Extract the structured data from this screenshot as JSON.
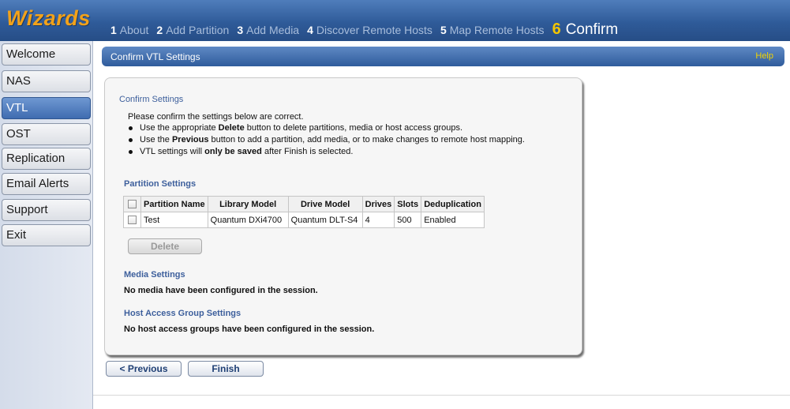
{
  "brand": "Wizards",
  "steps": [
    {
      "num": "1",
      "label": "About"
    },
    {
      "num": "2",
      "label": "Add Partition"
    },
    {
      "num": "3",
      "label": "Add Media"
    },
    {
      "num": "4",
      "label": "Discover Remote Hosts"
    },
    {
      "num": "5",
      "label": "Map Remote Hosts"
    },
    {
      "num": "6",
      "label": "Confirm"
    }
  ],
  "sidebar": {
    "items": [
      {
        "label": "Welcome"
      },
      {
        "label": "NAS"
      },
      {
        "label": "VTL"
      },
      {
        "label": "OST"
      },
      {
        "label": "Replication"
      },
      {
        "label": "Email Alerts"
      },
      {
        "label": "Support"
      },
      {
        "label": "Exit"
      }
    ],
    "active": "VTL"
  },
  "panel": {
    "title": "Confirm VTL Settings",
    "help": "Help"
  },
  "confirm": {
    "title": "Confirm Settings",
    "intro": "Please confirm the settings below are correct.",
    "bullets": [
      {
        "pre": "Use the appropriate ",
        "bold": "Delete",
        "post": " button to delete partitions, media or host access groups."
      },
      {
        "pre": "Use the ",
        "bold": "Previous",
        "post": " button to add a partition, add media, or to make changes to remote host mapping."
      },
      {
        "pre": "VTL settings will ",
        "bold": "only be saved",
        "post": " after Finish is selected."
      }
    ]
  },
  "partition": {
    "title": "Partition Settings",
    "columns": [
      "Partition Name",
      "Library Model",
      "Drive Model",
      "Drives",
      "Slots",
      "Deduplication"
    ],
    "rows": [
      [
        "Test",
        "Quantum DXi4700",
        "Quantum DLT-S4",
        "4",
        "500",
        "Enabled"
      ]
    ],
    "delete_label": "Delete"
  },
  "media": {
    "title": "Media Settings",
    "message": "No media have been configured in the session."
  },
  "hostaccess": {
    "title": "Host Access Group Settings",
    "message": "No host access groups have been configured in the session."
  },
  "buttons": {
    "previous": "< Previous",
    "finish": "Finish"
  },
  "colors": {
    "header_blue": "#2f5b99",
    "brand_orange": "#f2a21a",
    "active_step_yellow": "#f3c500",
    "section_title_blue": "#3d5f9c",
    "help_yellow": "#f3d400"
  }
}
